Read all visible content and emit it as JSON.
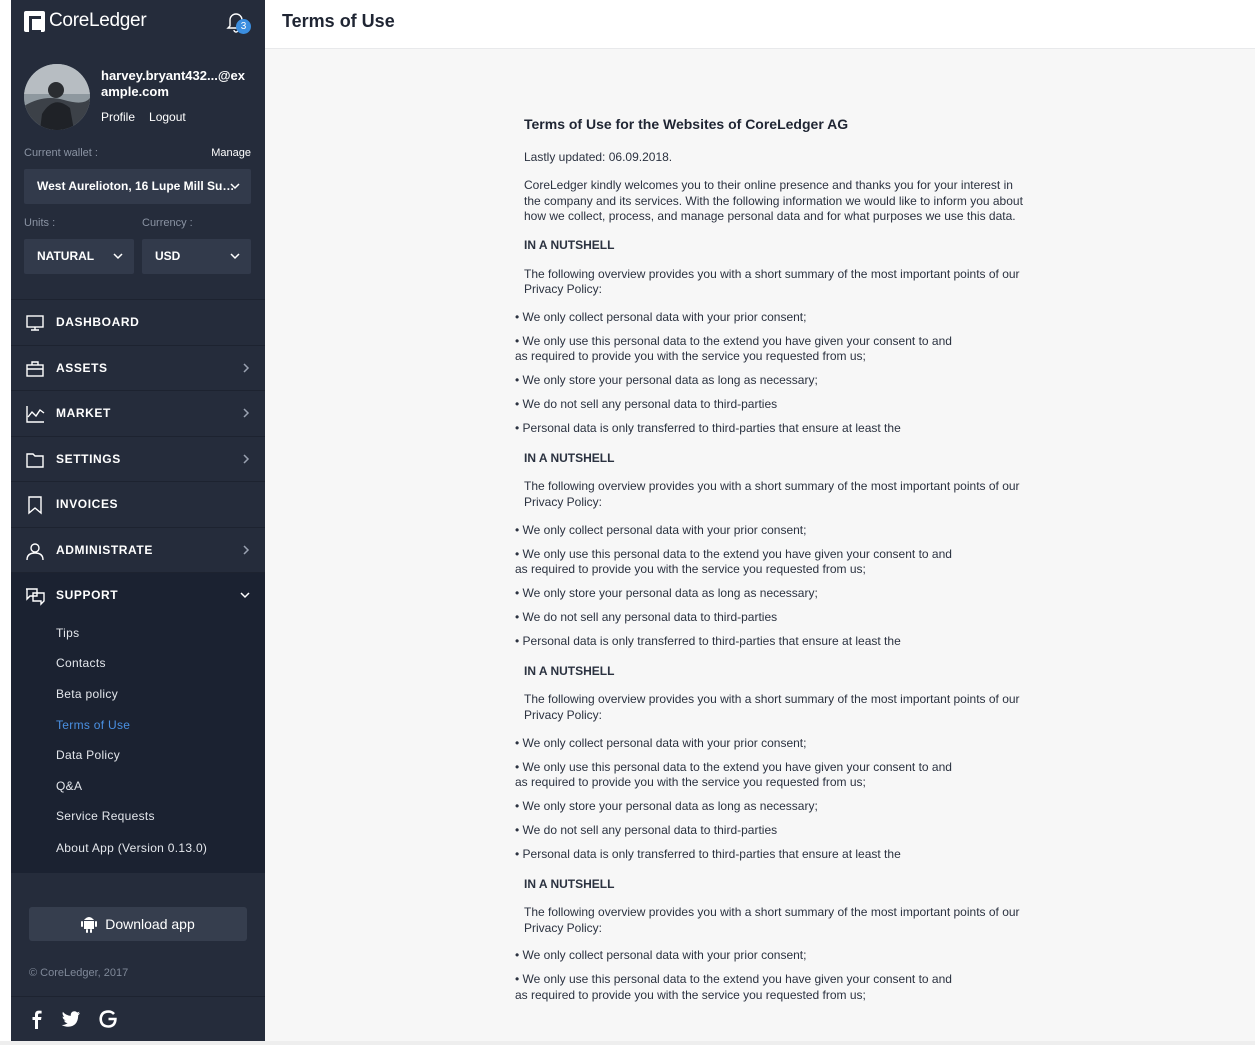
{
  "app": {
    "brand": "CoreLedger",
    "notifications_count": "3",
    "user_email": "harvey.bryant432...@example.com",
    "profile_link": "Profile",
    "logout_link": "Logout"
  },
  "wallet": {
    "label": "Current wallet :",
    "manage": "Manage",
    "selected": "West Aurelioton, 16 Lupe Mill Su…"
  },
  "units": {
    "label": "Units :",
    "selected": "NATURAL"
  },
  "currency": {
    "label": "Currency :",
    "selected": "USD"
  },
  "nav": {
    "dashboard": "DASHBOARD",
    "assets": "ASSETS",
    "market": "MARKET",
    "settings": "SETTINGS",
    "invoices": "INVOICES",
    "administrate": "ADMINISTRATE",
    "support": "SUPPORT"
  },
  "support_items": [
    "Tips",
    "Contacts",
    "Beta policy",
    "Terms of Use",
    "Data Policy",
    "Q&A",
    "Service Requests",
    "About App (Version 0.13.0)"
  ],
  "download_app": "Download app",
  "copyright": "© CoreLedger, 2017",
  "page": {
    "title": "Terms of Use"
  },
  "document": {
    "heading": "Terms of Use for the Websites of CoreLedger AG",
    "updated": "Lastly updated: 06.09.2018.",
    "intro": "CoreLedger kindly welcomes you to their online presence and thanks you for your interest in the company and its services. With the following information we would like to inform you about how we collect, process, and manage personal data and for what purposes we use this data.",
    "section_title": "IN A NUTSHELL",
    "section_intro": "The following overview provides you with a short summary of the most important points of our Privacy Policy:",
    "bullets": [
      "• We only collect personal data with your prior consent;",
      "• We only use this personal data to the extend you have given your consent to and as required to provide you with the service you requested from us;",
      "• We only store your personal data as long as necessary;",
      "• We do not sell any personal data to third-parties",
      "• Personal data is only transferred to third-parties that ensure at least the"
    ]
  },
  "colors": {
    "sidebar": "#252c3b",
    "support_bg": "#1b2231",
    "accent": "#4a90e2",
    "content_bg": "#f7f7f7"
  }
}
